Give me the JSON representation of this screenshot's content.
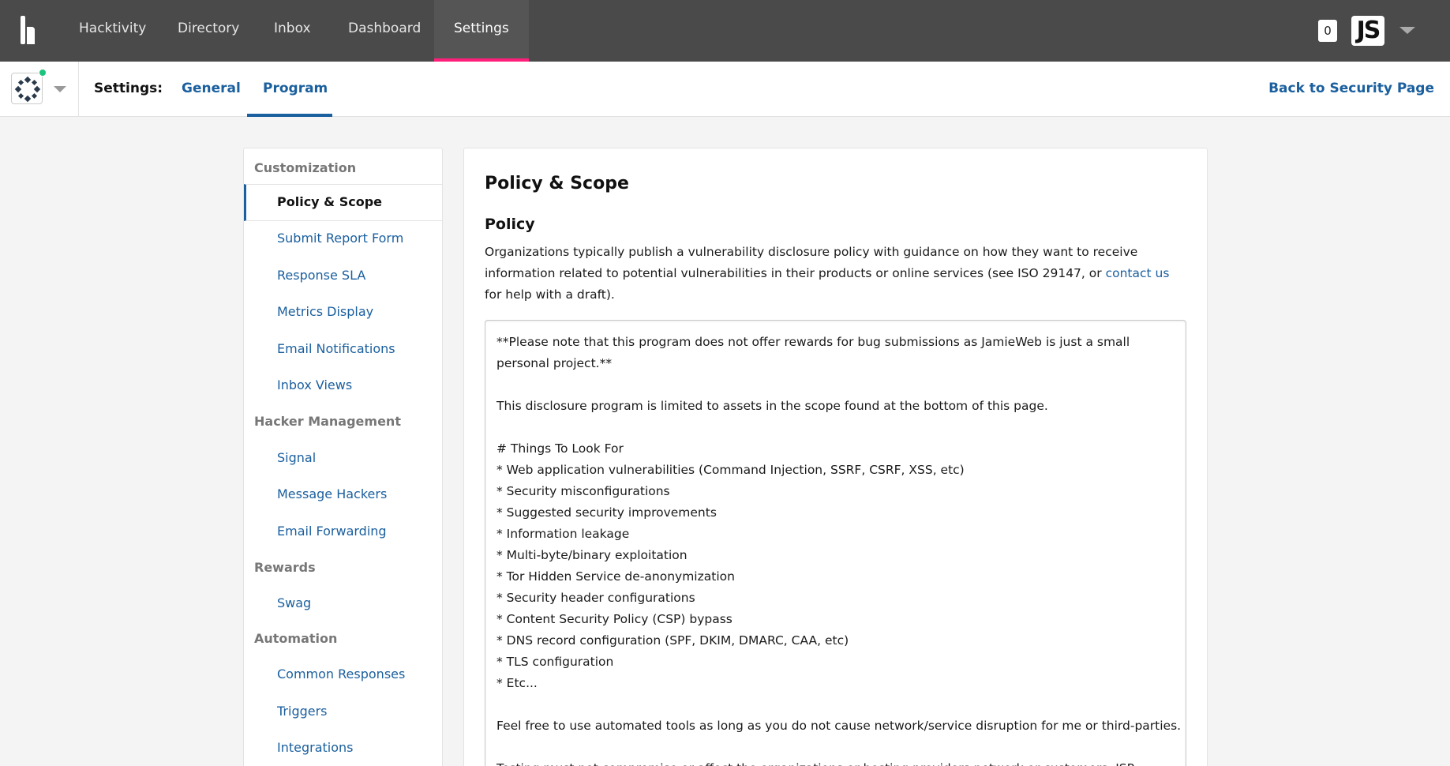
{
  "topnav": {
    "items": [
      "Hacktivity",
      "Directory",
      "Inbox",
      "Dashboard",
      "Settings"
    ],
    "active": "Settings",
    "notification_count": "0",
    "avatar_initials": "JS"
  },
  "subnav": {
    "settings_label": "Settings:",
    "tabs": [
      "General",
      "Program"
    ],
    "active_tab": "Program",
    "back_link": "Back to Security Page"
  },
  "sidebar": {
    "sections": [
      {
        "title": "Customization",
        "items": [
          "Policy & Scope",
          "Submit Report Form",
          "Response SLA",
          "Metrics Display",
          "Email Notifications",
          "Inbox Views"
        ]
      },
      {
        "title": "Hacker Management",
        "items": [
          "Signal",
          "Message Hackers",
          "Email Forwarding"
        ]
      },
      {
        "title": "Rewards",
        "items": [
          "Swag"
        ]
      },
      {
        "title": "Automation",
        "items": [
          "Common Responses",
          "Triggers",
          "Integrations"
        ]
      }
    ],
    "active_item": "Policy & Scope"
  },
  "main": {
    "title": "Policy & Scope",
    "section_title": "Policy",
    "description_before": "Organizations typically publish a vulnerability disclosure policy with guidance on how they want to receive information related to potential vulnerabilities in their products or online services (see ISO 29147, or ",
    "description_link": "contact us",
    "description_after": " for help with a draft).",
    "policy_lines": [
      "**Please note that this program does not offer rewards for bug submissions as JamieWeb is just a small",
      "personal project.**",
      "",
      "This disclosure program is limited to assets in the scope found at the bottom of this page.",
      "",
      "# Things To Look For",
      "* Web application vulnerabilities (Command Injection, SSRF, CSRF, XSS, etc)",
      "* Security misconfigurations",
      "* Suggested security improvements",
      "* Information leakage",
      "* Multi-byte/binary exploitation",
      "* Tor Hidden Service de-anonymization",
      "* Security header configurations",
      "* Content Security Policy (CSP) bypass",
      "* DNS record configuration (SPF, DKIM, DMARC, CAA, etc)",
      "* TLS configuration",
      "* Etc...",
      "",
      "Feel free to use automated tools as long as you do not cause network/service disruption for me or third-parties.",
      "",
      "Testing must not compromise or affect the organizations or hosting providers network or customers. ISP"
    ]
  }
}
